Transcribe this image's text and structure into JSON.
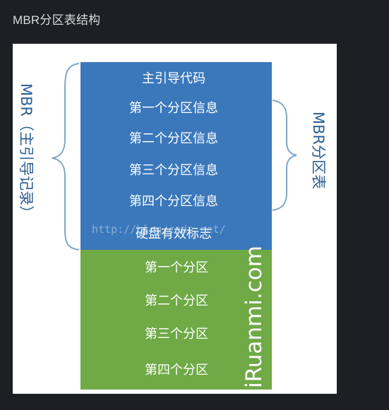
{
  "page": {
    "title": "MBR分区表结构"
  },
  "diagram": {
    "mbr_blocks": [
      "主引导代码",
      "第一个分区信息",
      "第二个分区信息",
      "第三个分区信息",
      "第四个分区信息",
      "硬盘有效标志"
    ],
    "partition_blocks": [
      "第一个分区",
      "第二个分区",
      "第三个分区",
      "第四个分区"
    ],
    "left_brace_label": "MBR（主引导记录）",
    "right_brace_label": "MBR分区表",
    "watermark_vertical": "iRuanmi.com",
    "watermark_url": "http://blog.csdn.net/",
    "colors": {
      "mbr_fill": "#3b78bb",
      "partition_fill": "#6faa46",
      "brace": "#7fa6c9",
      "label_text": "#2a5f93",
      "block_text": "#ffffff"
    }
  }
}
